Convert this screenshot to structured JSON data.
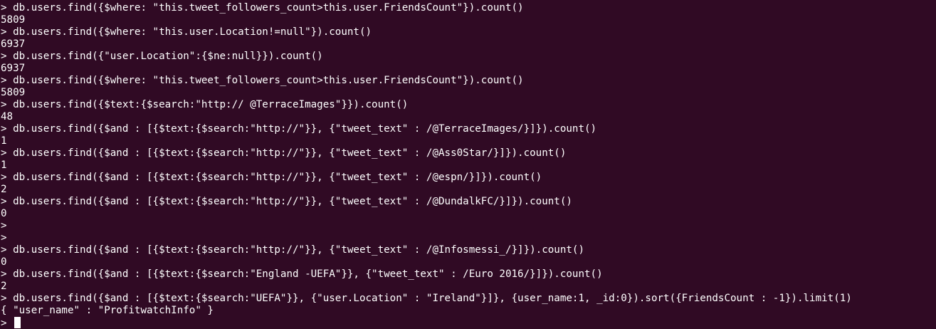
{
  "terminal": {
    "background": "#300a24",
    "foreground": "#ffffff",
    "lines": [
      "> db.users.find({$where: \"this.tweet_followers_count>this.user.FriendsCount\"}).count()",
      "5809",
      "> db.users.find({$where: \"this.user.Location!=null\"}).count()",
      "6937",
      "> db.users.find({\"user.Location\":{$ne:null}}).count()",
      "6937",
      "> db.users.find({$where: \"this.tweet_followers_count>this.user.FriendsCount\"}).count()",
      "5809",
      "> db.users.find({$text:{$search:\"http:// @TerraceImages\"}}).count()",
      "48",
      "> db.users.find({$and : [{$text:{$search:\"http://\"}}, {\"tweet_text\" : /@TerraceImages/}]}).count()",
      "1",
      "> db.users.find({$and : [{$text:{$search:\"http://\"}}, {\"tweet_text\" : /@Ass0Star/}]}).count()",
      "1",
      "> db.users.find({$and : [{$text:{$search:\"http://\"}}, {\"tweet_text\" : /@espn/}]}).count()",
      "2",
      "> db.users.find({$and : [{$text:{$search:\"http://\"}}, {\"tweet_text\" : /@DundalkFC/}]}).count()",
      "0",
      ">",
      ">",
      "> db.users.find({$and : [{$text:{$search:\"http://\"}}, {\"tweet_text\" : /@Infosmessi_/}]}).count()",
      "0",
      "> db.users.find({$and : [{$text:{$search:\"England -UEFA\"}}, {\"tweet_text\" : /Euro 2016/}]}).count()",
      "2",
      "> db.users.find({$and : [{$text:{$search:\"UEFA\"}}, {\"user.Location\" : \"Ireland\"}]}, {user_name:1, _id:0}).sort({FriendsCount : -1}).limit(1)",
      "{ \"user_name\" : \"ProfitwatchInfo\" }"
    ],
    "prompt": ">"
  }
}
